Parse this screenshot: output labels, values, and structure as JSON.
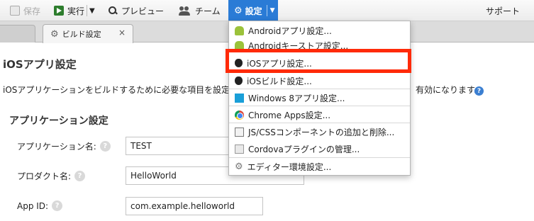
{
  "toolbar": {
    "save": "保存",
    "run": "実行",
    "run_caret": "▼",
    "preview": "プレビュー",
    "team": "チーム",
    "settings": "設定",
    "settings_caret": "▼",
    "support": "サポート"
  },
  "tab": {
    "label": "ビルド設定",
    "close": "×"
  },
  "page": {
    "title": "iOSアプリ設定",
    "description": "iOSアプリケーションをビルドするために必要な項目を設定し",
    "description_tail": "有効になります。",
    "section_title": "アプリケーション設定"
  },
  "form": {
    "app_name_label": "アプリケーション名:",
    "app_name_value": "TEST",
    "product_name_label": "プロダクト名:",
    "product_name_value": "HelloWorld",
    "app_id_label": "App ID:",
    "app_id_value": "com.example.helloworld",
    "help_glyph": "?"
  },
  "menu": {
    "items": [
      {
        "label": "Androidアプリ設定...",
        "icon": "android-icon"
      },
      {
        "label": "Androidキーストア設定...",
        "icon": "android-icon"
      },
      {
        "label": "iOSアプリ設定...",
        "icon": "apple-icon"
      },
      {
        "label": "iOSビルド設定...",
        "icon": "apple-icon"
      },
      {
        "label": "Windows 8アプリ設定...",
        "icon": "windows-icon"
      },
      {
        "label": "Chrome Apps設定...",
        "icon": "chrome-icon"
      },
      {
        "label": "JS/CSSコンポーネントの追加と削除...",
        "icon": "js-css-icon"
      },
      {
        "label": "Cordovaプラグインの管理...",
        "icon": "cordova-icon"
      },
      {
        "label": "エディター環境設定...",
        "icon": "gear-icon"
      }
    ]
  },
  "colors": {
    "accent": "#2a7bd6",
    "highlight": "#ff2a08"
  }
}
